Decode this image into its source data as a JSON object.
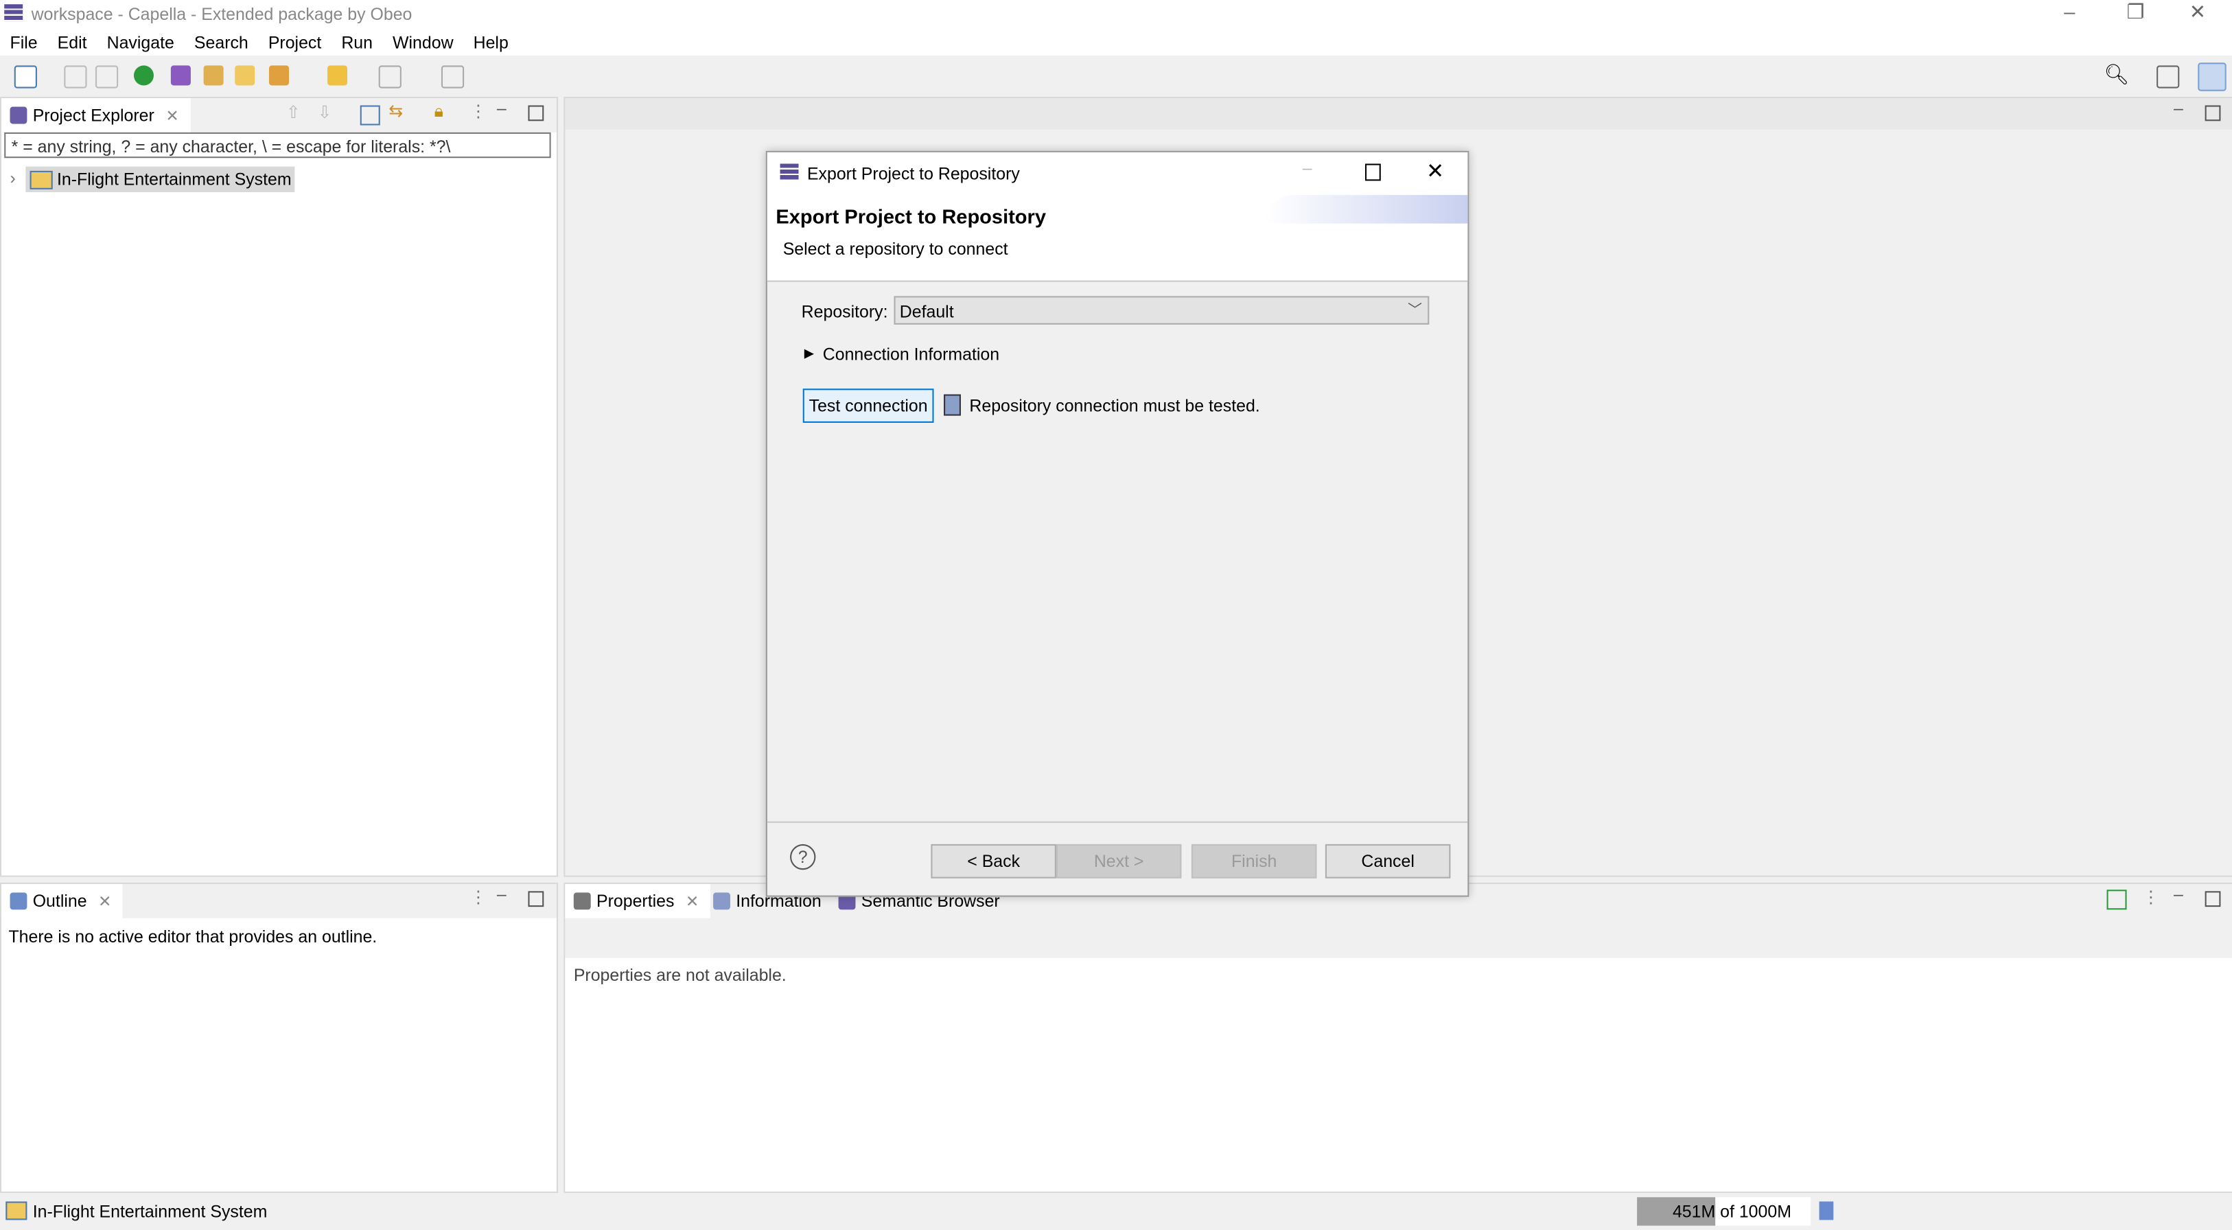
{
  "window": {
    "title": "workspace - Capella - Extended package by Obeo"
  },
  "menu": [
    "File",
    "Edit",
    "Navigate",
    "Search",
    "Project",
    "Run",
    "Window",
    "Help"
  ],
  "project_explorer": {
    "tab": "Project Explorer",
    "filter": "* = any string, ? = any character, \\ = escape for literals: *?\\",
    "items": [
      {
        "label": "In-Flight Entertainment System",
        "expanded": false,
        "selected": true
      }
    ]
  },
  "outline": {
    "tab": "Outline",
    "message": "There is no active editor that provides an outline."
  },
  "bottom_tabs": {
    "tabs": [
      "Properties",
      "Information",
      "Semantic Browser"
    ],
    "active": "Properties",
    "message": "Properties are not available."
  },
  "dialog": {
    "window_title": "Export Project to Repository",
    "heading": "Export Project to Repository",
    "subheading": "Select a repository to connect",
    "repository_label": "Repository:",
    "repository_value": "Default",
    "section": "Connection Information",
    "test_button": "Test connection",
    "test_status": "Repository connection must be tested.",
    "back": "< Back",
    "next": "Next >",
    "finish": "Finish",
    "cancel": "Cancel",
    "help_icon": "?"
  },
  "status": {
    "selection": "In-Flight Entertainment System",
    "heap_used": "451M",
    "heap_text": "of 1000M",
    "heap_fraction": 0.451
  },
  "colors": {
    "accent": "#0078d7",
    "selection": "#d9d9d9"
  }
}
